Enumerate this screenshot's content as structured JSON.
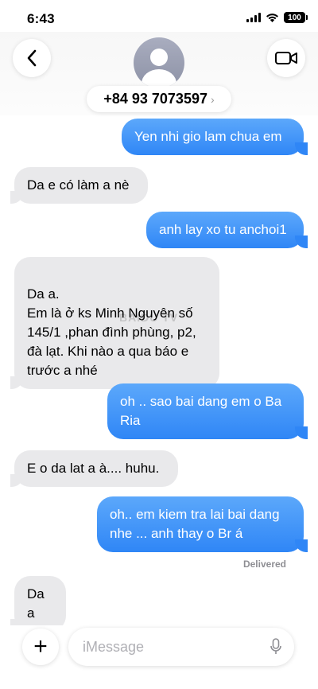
{
  "status_bar": {
    "time": "6:43",
    "battery": "100"
  },
  "header": {
    "contact": "+84 93 7073597",
    "chevron": "›"
  },
  "messages": [
    {
      "dir": "out",
      "text": "Yen nhi gio lam chua em"
    },
    {
      "dir": "in",
      "text": "Da e có làm a nè"
    },
    {
      "dir": "out",
      "text": "anh lay xo tu anchoi1"
    },
    {
      "dir": "in",
      "text": "Da a.\nEm là ở ks Minh Nguyên số 145/1 ,phan đình phùng, p2, đà lạt. Khi nào a qua báo e trước a nhé"
    },
    {
      "dir": "out",
      "text": "oh .. sao bai dang em o Ba Ria"
    },
    {
      "dir": "in",
      "text": "E o da lat a à.... huhu."
    },
    {
      "dir": "out",
      "text": "oh.. em kiem tra lai bai dang nhe ... anh thay o Br á"
    },
    {
      "dir": "in",
      "text": "Da a"
    }
  ],
  "delivered_label": "Delivered",
  "watermark": "BAIDU TV",
  "composer": {
    "plus": "+",
    "placeholder": "iMessage"
  },
  "colors": {
    "outgoing": "#2f86f6",
    "incoming": "#e9e9eb"
  }
}
